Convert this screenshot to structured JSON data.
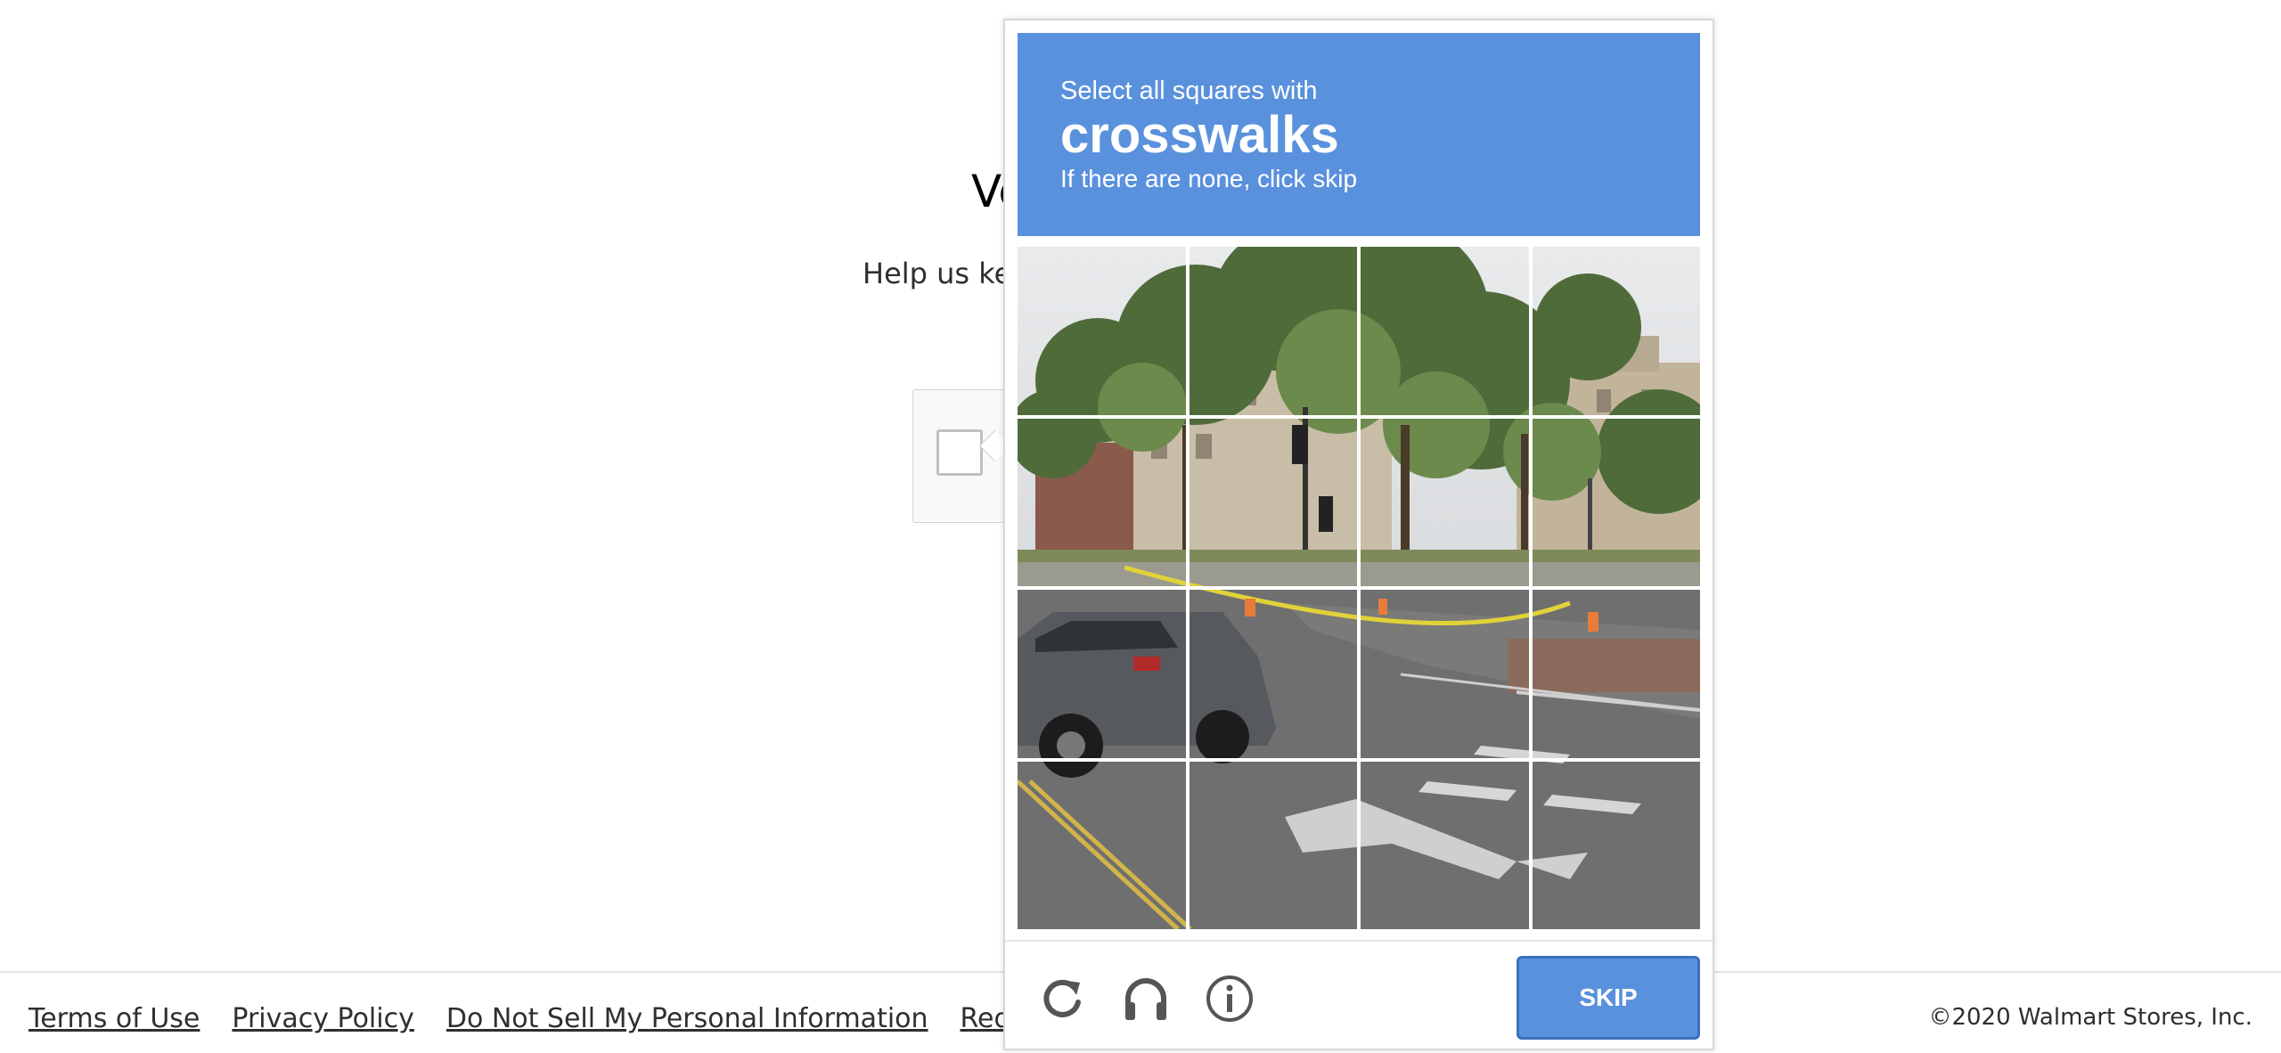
{
  "page": {
    "title_visible": "Ve",
    "subtitle_visible": "Help us kee"
  },
  "challenge": {
    "line1": "Select all squares with",
    "keyword": "crosswalks",
    "line3": "If there are none, click skip",
    "grid_rows": 4,
    "grid_cols": 4,
    "skip_label": "SKIP",
    "colors": {
      "prompt_bg": "#5a91dd",
      "button_bg": "#5a91dd"
    },
    "icons": [
      "reload-icon",
      "audio-icon",
      "info-icon"
    ]
  },
  "footer": {
    "links": [
      "Terms of Use",
      "Privacy Policy",
      "Do Not Sell My Personal Information",
      "Request My Perso"
    ],
    "copyright": "©2020 Walmart Stores, Inc."
  }
}
